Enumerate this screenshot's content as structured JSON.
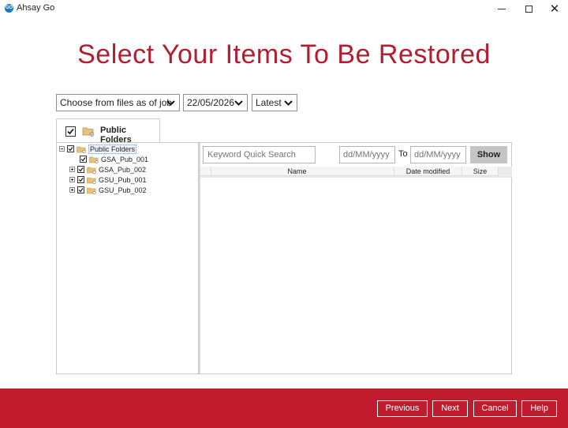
{
  "window": {
    "title": "Ahsay Go",
    "logo_text": "GO"
  },
  "heading": "Select Your Items To Be Restored",
  "selectors": {
    "job_mode": "Choose from files as of job",
    "date": "22/05/2026",
    "version": "Latest"
  },
  "tab": {
    "label": "Public Folders",
    "checked": true
  },
  "tree": {
    "root": {
      "label": "Public Folders",
      "expanded": true,
      "checked": true
    },
    "children": [
      {
        "label": "GSA_Pub_001",
        "checked": true,
        "expandable": false
      },
      {
        "label": "GSA_Pub_002",
        "checked": true,
        "expandable": true
      },
      {
        "label": "GSU_Pub_001",
        "checked": true,
        "expandable": true
      },
      {
        "label": "GSU_Pub_002",
        "checked": true,
        "expandable": true
      }
    ]
  },
  "filter": {
    "search_placeholder": "Keyword Quick Search",
    "date_from_placeholder": "dd/MM/yyyy",
    "to_label": "To",
    "date_to_placeholder": "dd/MM/yyyy",
    "show_label": "Show"
  },
  "grid": {
    "columns": [
      "Name",
      "Date modified",
      "Size"
    ],
    "rows": []
  },
  "footer": {
    "previous_label": "Previous",
    "next_label": "Next",
    "cancel_label": "Cancel",
    "help_label": "Help"
  },
  "colors": {
    "accent": "#c01c2e",
    "heading": "#b31d2f",
    "show_button": "#c4c4c4"
  }
}
